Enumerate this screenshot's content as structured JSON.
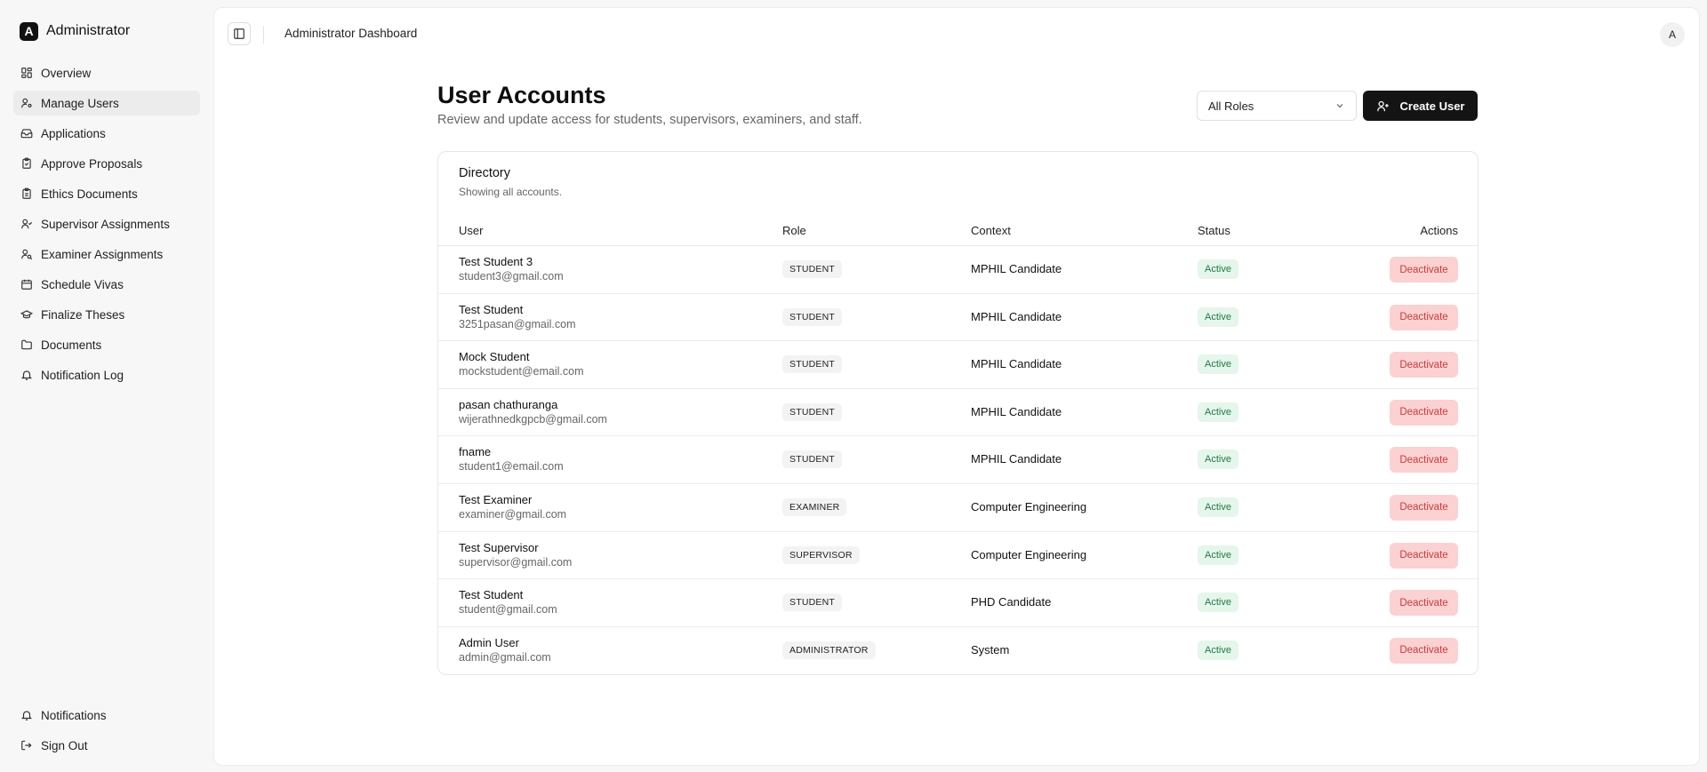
{
  "sidebar": {
    "brand_letter": "A",
    "brand_name": "Administrator",
    "items": [
      {
        "label": "Overview",
        "icon": "grid-icon"
      },
      {
        "label": "Manage Users",
        "icon": "user-cog-icon"
      },
      {
        "label": "Applications",
        "icon": "inbox-icon"
      },
      {
        "label": "Approve Proposals",
        "icon": "clipboard-check-icon"
      },
      {
        "label": "Ethics Documents",
        "icon": "clipboard-icon"
      },
      {
        "label": "Supervisor Assignments",
        "icon": "user-check-icon"
      },
      {
        "label": "Examiner Assignments",
        "icon": "user-search-icon"
      },
      {
        "label": "Schedule Vivas",
        "icon": "calendar-icon"
      },
      {
        "label": "Finalize Theses",
        "icon": "graduation-cap-icon"
      },
      {
        "label": "Documents",
        "icon": "folder-icon"
      },
      {
        "label": "Notification Log",
        "icon": "bell-icon"
      }
    ],
    "bottom": [
      {
        "label": "Notifications",
        "icon": "bell-icon"
      },
      {
        "label": "Sign Out",
        "icon": "log-out-icon"
      }
    ]
  },
  "header": {
    "title": "Administrator Dashboard",
    "avatar": "A"
  },
  "page": {
    "title": "User Accounts",
    "subtitle": "Review and update access for students, supervisors, examiners, and staff.",
    "role_filter": "All Roles",
    "create_label": "Create User"
  },
  "directory": {
    "title": "Directory",
    "subtitle": "Showing all accounts.",
    "columns": {
      "user": "User",
      "role": "Role",
      "context": "Context",
      "status": "Status",
      "actions": "Actions"
    },
    "rows": [
      {
        "name": "Test Student 3",
        "email": "student3@gmail.com",
        "role": "STUDENT",
        "context": "MPHIL Candidate",
        "status": "Active",
        "action": "Deactivate"
      },
      {
        "name": "Test Student",
        "email": "3251pasan@gmail.com",
        "role": "STUDENT",
        "context": "MPHIL Candidate",
        "status": "Active",
        "action": "Deactivate"
      },
      {
        "name": "Mock Student",
        "email": "mockstudent@email.com",
        "role": "STUDENT",
        "context": "MPHIL Candidate",
        "status": "Active",
        "action": "Deactivate"
      },
      {
        "name": "pasan chathuranga",
        "email": "wijerathnedkgpcb@gmail.com",
        "role": "STUDENT",
        "context": "MPHIL Candidate",
        "status": "Active",
        "action": "Deactivate"
      },
      {
        "name": "fname",
        "email": "student1@email.com",
        "role": "STUDENT",
        "context": "MPHIL Candidate",
        "status": "Active",
        "action": "Deactivate"
      },
      {
        "name": "Test Examiner",
        "email": "examiner@gmail.com",
        "role": "EXAMINER",
        "context": "Computer Engineering",
        "status": "Active",
        "action": "Deactivate"
      },
      {
        "name": "Test Supervisor",
        "email": "supervisor@gmail.com",
        "role": "SUPERVISOR",
        "context": "Computer Engineering",
        "status": "Active",
        "action": "Deactivate"
      },
      {
        "name": "Test Student",
        "email": "student@gmail.com",
        "role": "STUDENT",
        "context": "PHD Candidate",
        "status": "Active",
        "action": "Deactivate"
      },
      {
        "name": "Admin User",
        "email": "admin@gmail.com",
        "role": "ADMINISTRATOR",
        "context": "System",
        "status": "Active",
        "action": "Deactivate"
      }
    ]
  },
  "colors": {
    "primary_button": "#141414",
    "active_badge_bg": "#e5f6eb",
    "active_badge_text": "#217a47",
    "deactivate_bg": "#fbd1d1",
    "deactivate_text": "#c53d3d"
  }
}
